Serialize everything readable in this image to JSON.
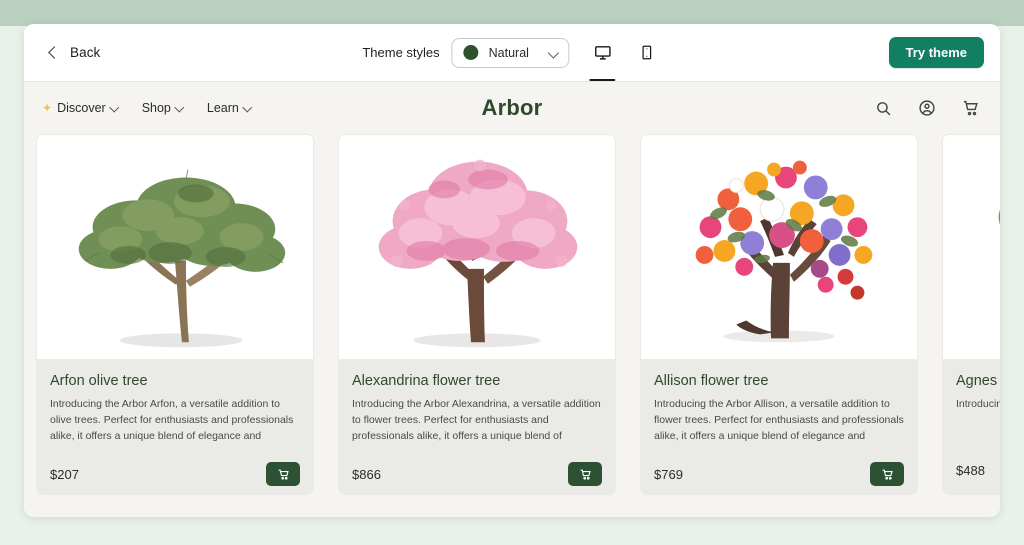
{
  "editor": {
    "back_label": "Back",
    "theme_styles_label": "Theme styles",
    "style_selected": "Natural",
    "style_swatch_color": "#2f5130",
    "devices": [
      {
        "name": "desktop-view-button",
        "icon": "desktop-icon",
        "active": true
      },
      {
        "name": "mobile-view-button",
        "icon": "mobile-icon",
        "active": false
      }
    ],
    "try_theme_label": "Try theme",
    "try_theme_color": "#127f63"
  },
  "storefront": {
    "brand": "Arbor",
    "brand_color": "#2d4a2e",
    "nav_links": [
      {
        "label": "Discover",
        "has_sparkle": true,
        "has_chevron": true
      },
      {
        "label": "Shop",
        "has_sparkle": false,
        "has_chevron": true
      },
      {
        "label": "Learn",
        "has_sparkle": false,
        "has_chevron": true
      }
    ],
    "nav_icons": [
      {
        "name": "search-icon"
      },
      {
        "name": "account-icon"
      },
      {
        "name": "cart-icon"
      }
    ],
    "products": [
      {
        "title": "Arfon olive tree",
        "description": "Introducing the Arbor Arfon, a versatile addition to olive trees. Perfect for enthusiasts and professionals alike, it offers a unique blend of elegance and performance. It's the ideal...",
        "price": "$207",
        "image": "olive-tree-photo",
        "cart_button_label": "add-to-cart"
      },
      {
        "title": "Alexandrina flower tree",
        "description": "Introducing the Arbor Alexandrina, a versatile addition to flower trees. Perfect for enthusiasts and professionals alike, it offers a unique blend of elegance and performance. It's the...",
        "price": "$866",
        "image": "pink-blossom-tree-photo",
        "cart_button_label": "add-to-cart"
      },
      {
        "title": "Allison flower tree",
        "description": "Introducing the Arbor Allison, a versatile addition to flower trees. Perfect for enthusiasts and professionals alike, it offers a unique blend of elegance and performance. It's the ideal...",
        "price": "$769",
        "image": "multicolor-flower-tree-photo",
        "cart_button_label": "add-to-cart"
      },
      {
        "title": "Agnes b",
        "description": "Introducing trees. Perfec unique blen",
        "price": "$488",
        "image": "green-tree-photo",
        "cart_button_label": "add-to-cart"
      }
    ]
  }
}
